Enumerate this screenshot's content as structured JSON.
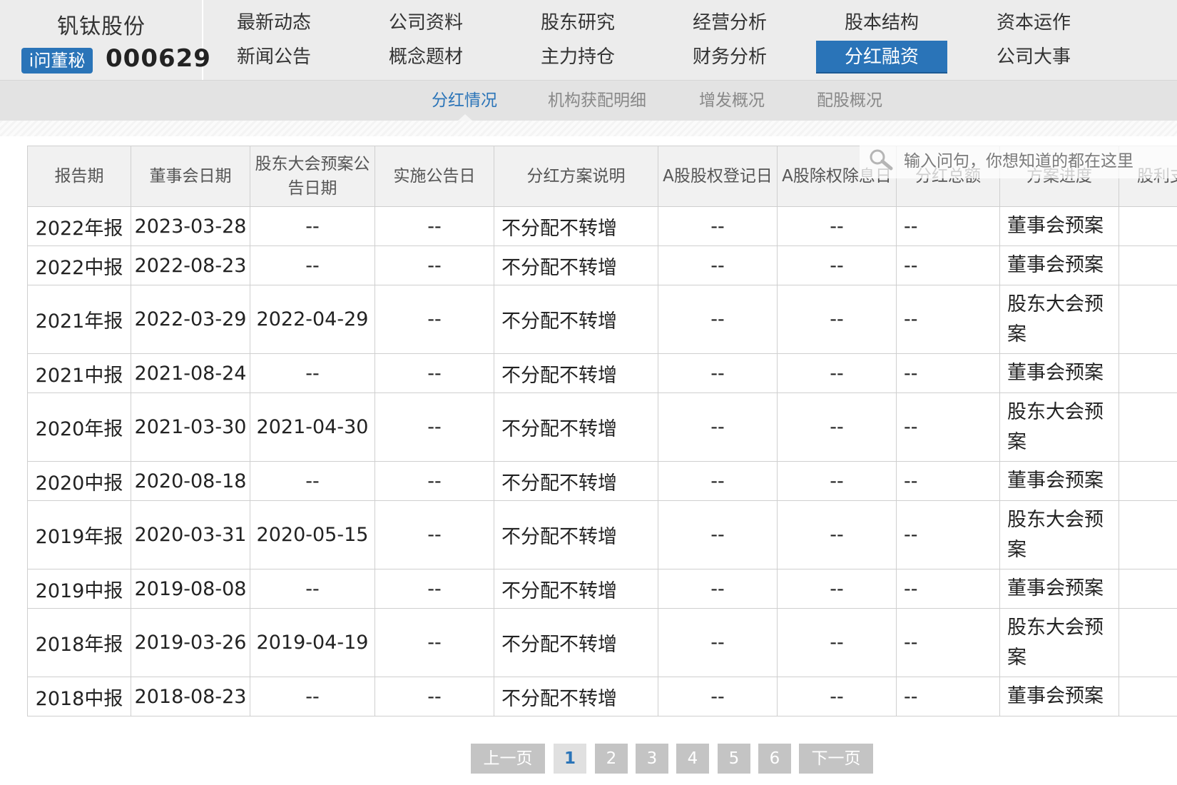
{
  "header": {
    "stock_name": "钒钛股份",
    "dongmi_label": "i问董秘",
    "stock_code": "000629",
    "nav_row1": [
      "最新动态",
      "公司资料",
      "股东研究",
      "经营分析",
      "股本结构",
      "资本运作"
    ],
    "nav_row2": [
      "新闻公告",
      "概念题材",
      "主力持仓",
      "财务分析",
      "分红融资",
      "公司大事"
    ],
    "active_nav": "分红融资"
  },
  "subnav": {
    "items": [
      "分红情况",
      "机构获配明细",
      "增发概况",
      "配股概况"
    ],
    "active": "分红情况"
  },
  "search": {
    "placeholder": "输入问句，你想知道的都在这里"
  },
  "table": {
    "headers": [
      "报告期",
      "董事会日期",
      "股东大会预案公告日期",
      "实施公告日",
      "分红方案说明",
      "A股股权登记日",
      "A股除权除息日",
      "分红总额",
      "方案进度",
      "股利支"
    ],
    "rows": [
      [
        "2022年报",
        "2023-03-28",
        "--",
        "--",
        "不分配不转增",
        "--",
        "--",
        "--",
        "董事会预案",
        ""
      ],
      [
        "2022中报",
        "2022-08-23",
        "--",
        "--",
        "不分配不转增",
        "--",
        "--",
        "--",
        "董事会预案",
        ""
      ],
      [
        "2021年报",
        "2022-03-29",
        "2022-04-29",
        "--",
        "不分配不转增",
        "--",
        "--",
        "--",
        "股东大会预案",
        ""
      ],
      [
        "2021中报",
        "2021-08-24",
        "--",
        "--",
        "不分配不转增",
        "--",
        "--",
        "--",
        "董事会预案",
        ""
      ],
      [
        "2020年报",
        "2021-03-30",
        "2021-04-30",
        "--",
        "不分配不转增",
        "--",
        "--",
        "--",
        "股东大会预案",
        ""
      ],
      [
        "2020中报",
        "2020-08-18",
        "--",
        "--",
        "不分配不转增",
        "--",
        "--",
        "--",
        "董事会预案",
        ""
      ],
      [
        "2019年报",
        "2020-03-31",
        "2020-05-15",
        "--",
        "不分配不转增",
        "--",
        "--",
        "--",
        "股东大会预案",
        ""
      ],
      [
        "2019中报",
        "2019-08-08",
        "--",
        "--",
        "不分配不转增",
        "--",
        "--",
        "--",
        "董事会预案",
        ""
      ],
      [
        "2018年报",
        "2019-03-26",
        "2019-04-19",
        "--",
        "不分配不转增",
        "--",
        "--",
        "--",
        "股东大会预案",
        ""
      ],
      [
        "2018中报",
        "2018-08-23",
        "--",
        "--",
        "不分配不转增",
        "--",
        "--",
        "--",
        "董事会预案",
        ""
      ]
    ]
  },
  "pager": {
    "prev": "上一页",
    "next": "下一页",
    "pages": [
      "1",
      "2",
      "3",
      "4",
      "5",
      "6"
    ],
    "current": "1"
  },
  "colors": {
    "accent": "#2a74b8",
    "header_bg": "#ececec",
    "pager_bg": "#c4c4c4"
  }
}
